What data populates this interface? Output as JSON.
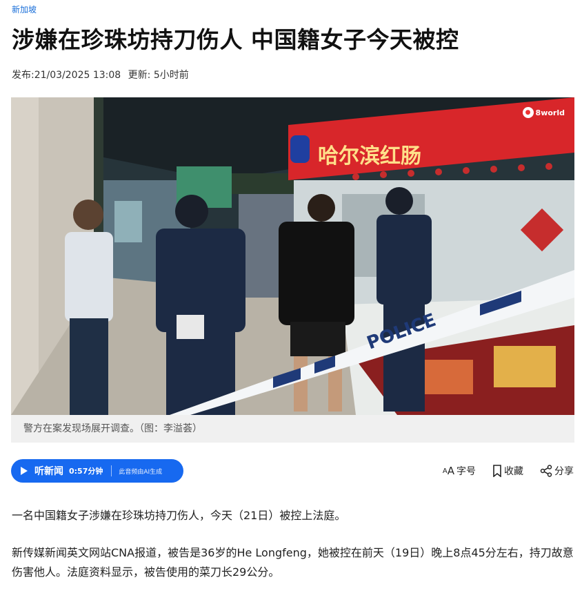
{
  "article": {
    "category": "新加坡",
    "title": "涉嫌在珍珠坊持刀伤人 中国籍女子今天被控",
    "published": "发布:21/03/2025 13:08",
    "updated": "更新: 5小时前",
    "image": {
      "watermark": "8world",
      "caption": "警方在案发现场展开调查。（图：李溢荟）",
      "sign_text": "哈尔滨红肠",
      "tape_text": "POLICE"
    },
    "listen": {
      "label": "听新闻",
      "duration": "0:57分钟",
      "ai_note": "此音频由AI生成"
    },
    "tools": {
      "font_size": "字号",
      "bookmark": "收藏",
      "share": "分享"
    },
    "paragraphs": [
      "一名中国籍女子涉嫌在珍珠坊持刀伤人，今天（21日）被控上法庭。",
      "新传媒新闻英文网站CNA报道，被告是36岁的He Longfeng，她被控在前天（19日）晚上8点45分左右，持刀故意伤害他人。法庭资料显示，被告使用的菜刀长29公分。"
    ]
  },
  "colors": {
    "accent": "#1769f0",
    "category": "#1a6fd9",
    "sign_red": "#d8262a"
  },
  "icons": [
    "play-icon",
    "font-size-icon",
    "bookmark-icon",
    "share-icon"
  ]
}
